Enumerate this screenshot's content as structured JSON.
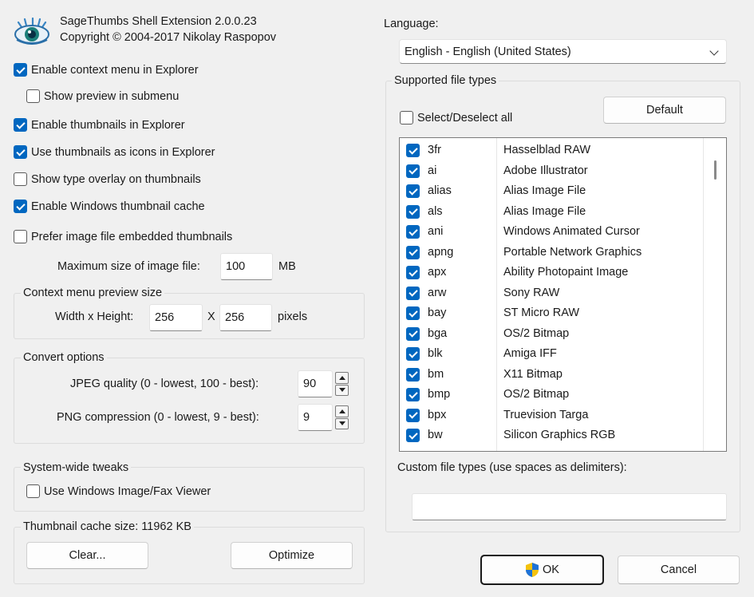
{
  "header": {
    "title": "SageThumbs Shell Extension 2.0.0.23",
    "copyright": "Copyright © 2004-2017 Nikolay Raspopov"
  },
  "options": {
    "enable_context_menu": {
      "label": "Enable context menu in Explorer",
      "checked": true
    },
    "show_preview_submenu": {
      "label": "Show preview in submenu",
      "checked": false
    },
    "enable_thumbnails": {
      "label": "Enable thumbnails in Explorer",
      "checked": true
    },
    "use_thumbnails_icons": {
      "label": "Use thumbnails as icons in Explorer",
      "checked": true
    },
    "show_type_overlay": {
      "label": "Show type overlay on thumbnails",
      "checked": false
    },
    "enable_windows_cache": {
      "label": "Enable Windows thumbnail cache",
      "checked": true
    },
    "prefer_embedded": {
      "label": "Prefer image file embedded thumbnails",
      "checked": false
    }
  },
  "max_size": {
    "label": "Maximum size of image file:",
    "value": "100",
    "unit": "MB"
  },
  "preview_size": {
    "title": "Context menu preview size",
    "label": "Width x Height:",
    "width": "256",
    "separator": "X",
    "height": "256",
    "unit": "pixels"
  },
  "convert": {
    "title": "Convert options",
    "jpeg_label": "JPEG quality (0 - lowest, 100 - best):",
    "jpeg_value": "90",
    "png_label": "PNG compression (0 - lowest, 9 - best):",
    "png_value": "9"
  },
  "tweaks": {
    "title": "System-wide tweaks",
    "image_fax_viewer": {
      "label": "Use Windows Image/Fax Viewer",
      "checked": false
    }
  },
  "cache": {
    "title": "Thumbnail cache size: 11962 KB",
    "clear_label": "Clear...",
    "optimize_label": "Optimize"
  },
  "language": {
    "label": "Language:",
    "selected": "English - English (United States)"
  },
  "file_types": {
    "title": "Supported file types",
    "select_all": {
      "label": "Select/Deselect all",
      "checked": false
    },
    "default_label": "Default",
    "rows": [
      {
        "ext": "3fr",
        "desc": "Hasselblad RAW",
        "checked": true
      },
      {
        "ext": "ai",
        "desc": "Adobe Illustrator",
        "checked": true
      },
      {
        "ext": "alias",
        "desc": "Alias Image File",
        "checked": true
      },
      {
        "ext": "als",
        "desc": "Alias Image File",
        "checked": true
      },
      {
        "ext": "ani",
        "desc": "Windows Animated Cursor",
        "checked": true
      },
      {
        "ext": "apng",
        "desc": "Portable Network Graphics",
        "checked": true
      },
      {
        "ext": "apx",
        "desc": "Ability Photopaint Image",
        "checked": true
      },
      {
        "ext": "arw",
        "desc": "Sony RAW",
        "checked": true
      },
      {
        "ext": "bay",
        "desc": "ST Micro RAW",
        "checked": true
      },
      {
        "ext": "bga",
        "desc": "OS/2 Bitmap",
        "checked": true
      },
      {
        "ext": "blk",
        "desc": "Amiga IFF",
        "checked": true
      },
      {
        "ext": "bm",
        "desc": "X11 Bitmap",
        "checked": true
      },
      {
        "ext": "bmp",
        "desc": "OS/2 Bitmap",
        "checked": true
      },
      {
        "ext": "bpx",
        "desc": "Truevision Targa",
        "checked": true
      },
      {
        "ext": "bw",
        "desc": "Silicon Graphics RGB",
        "checked": true
      }
    ],
    "custom_label": "Custom file types (use spaces as delimiters):",
    "custom_value": ""
  },
  "footer": {
    "ok_label": "OK",
    "cancel_label": "Cancel"
  },
  "colors": {
    "accent": "#0067c0",
    "background": "#f0f0f0"
  }
}
